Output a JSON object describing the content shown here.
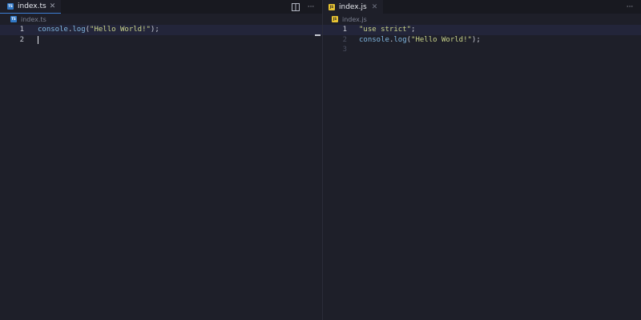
{
  "left": {
    "tab": {
      "label": "index.ts",
      "close": "✕",
      "icon": "ts-file-icon",
      "icon_text": "TS"
    },
    "actions": {
      "split": "split-editor-icon",
      "more": "···"
    },
    "breadcrumb": {
      "label": "index.ts"
    },
    "lines": [
      {
        "num": "1",
        "ident": "console",
        "dot": ".",
        "method": "log",
        "open": "(",
        "str": "\"Hello World!\"",
        "close": ");"
      },
      {
        "num": "2"
      }
    ]
  },
  "right": {
    "tab": {
      "label": "index.js",
      "close": "✕",
      "icon": "js-file-icon",
      "icon_text": "JS"
    },
    "actions": {
      "more": "···"
    },
    "breadcrumb": {
      "label": "index.js"
    },
    "lines": [
      {
        "num": "1",
        "str": "\"use strict\"",
        "close": ";"
      },
      {
        "num": "2",
        "ident": "console",
        "dot": ".",
        "method": "log",
        "open": "(",
        "str": "\"Hello World!\"",
        "close": ");"
      },
      {
        "num": "3"
      }
    ]
  },
  "colors": {
    "background": "#1e1f29",
    "tab_active_border": "#3d7fd6",
    "ts_icon": "#3178c6",
    "js_icon": "#e8c432"
  }
}
